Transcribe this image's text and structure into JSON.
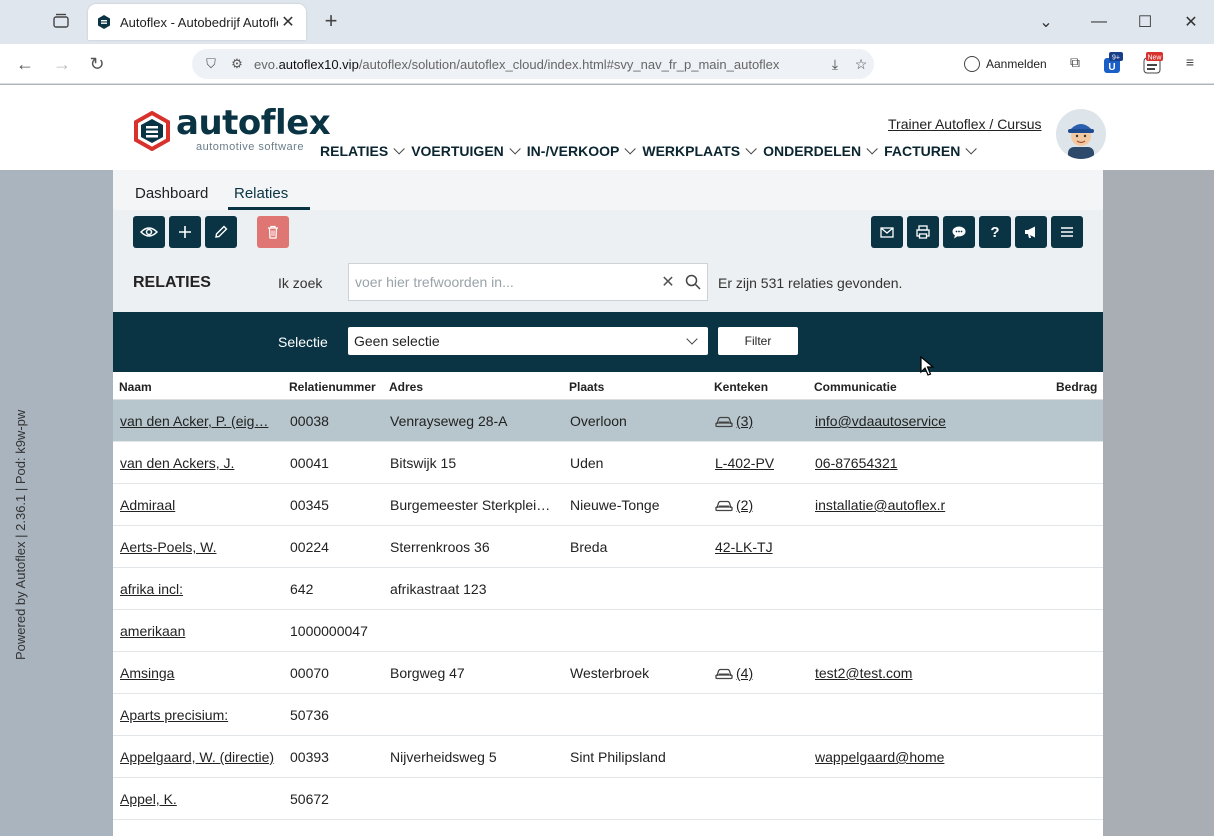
{
  "browser": {
    "tab_title": "Autoflex - Autobedrijf Autoflex",
    "url_prefix": "evo.",
    "url_domain": "autoflex10.vip",
    "url_path": "/autoflex/solution/autoflex_cloud/index.html#svy_nav_fr_p_main_autoflex",
    "signin_label": "Aanmelden",
    "ext_badge": "9+",
    "ext_badge2": "New"
  },
  "side_text": "Powered by Autoflex | 2.36.1 | Pod: k9w-pw",
  "header": {
    "logo_text": "autoflex",
    "logo_sub": "automotive software",
    "user_link": "Trainer Autoflex / Cursus",
    "nav": [
      "RELATIES",
      "VOERTUIGEN",
      "IN-/VERKOOP",
      "WERKPLAATS",
      "ONDERDELEN",
      "FACTUREN"
    ]
  },
  "subtabs": {
    "dashboard": "Dashboard",
    "relaties": "Relaties"
  },
  "page": {
    "title": "RELATIES",
    "search_label": "Ik zoek",
    "search_placeholder": "voer hier trefwoorden in...",
    "result_count": "Er zijn 531 relaties gevonden.",
    "selectie_label": "Selectie",
    "selectie_value": "Geen selectie",
    "filter_label": "Filter"
  },
  "table": {
    "headers": {
      "naam": "Naam",
      "relatienummer": "Relatienummer",
      "adres": "Adres",
      "plaats": "Plaats",
      "kenteken": "Kenteken",
      "communicatie": "Communicatie",
      "bedrag": "Bedrag"
    },
    "rows": [
      {
        "naam": "van den Acker, P. (eig…",
        "nr": "00038",
        "adres": "Venrayseweg 28-A",
        "plaats": "Overloon",
        "kenteken": "(3)",
        "kenteken_car": true,
        "comm": "info@vdaautoservice"
      },
      {
        "naam": "van den Ackers, J.",
        "nr": "00041",
        "adres": "Bitswijk 15",
        "plaats": "Uden",
        "kenteken": "L-402-PV",
        "kenteken_car": false,
        "comm": "06-87654321"
      },
      {
        "naam": "Admiraal",
        "nr": "00345",
        "adres": "Burgemeester Sterkplei…",
        "plaats": "Nieuwe-Tonge",
        "kenteken": "(2)",
        "kenteken_car": true,
        "comm": "installatie@autoflex.r"
      },
      {
        "naam": "Aerts-Poels, W.",
        "nr": "00224",
        "adres": "Sterrenkroos 36",
        "plaats": "Breda",
        "kenteken": "42-LK-TJ",
        "kenteken_car": false,
        "comm": ""
      },
      {
        "naam": "afrika incl:",
        "nr": "642",
        "adres": "afrikastraat 123",
        "plaats": "",
        "kenteken": "",
        "kenteken_car": false,
        "comm": ""
      },
      {
        "naam": "amerikaan",
        "nr": "1000000047",
        "adres": "",
        "plaats": "",
        "kenteken": "",
        "kenteken_car": false,
        "comm": ""
      },
      {
        "naam": "Amsinga",
        "nr": "00070",
        "adres": "Borgweg 47",
        "plaats": "Westerbroek",
        "kenteken": "(4)",
        "kenteken_car": true,
        "comm": "test2@test.com"
      },
      {
        "naam": "Aparts precisium:",
        "nr": "50736",
        "adres": "",
        "plaats": "",
        "kenteken": "",
        "kenteken_car": false,
        "comm": ""
      },
      {
        "naam": "Appelgaard, W. (directie)",
        "nr": "00393",
        "adres": "Nijverheidsweg 5",
        "plaats": "Sint Philipsland",
        "kenteken": "",
        "kenteken_car": false,
        "comm": "wappelgaard@home"
      },
      {
        "naam": "Appel, K.",
        "nr": "50672",
        "adres": "",
        "plaats": "",
        "kenteken": "",
        "kenteken_car": false,
        "comm": ""
      }
    ]
  },
  "colors": {
    "primary": "#0a3444",
    "delete": "#e07673",
    "selected_row": "#b7c6cd",
    "logo_red": "#d8322c"
  }
}
